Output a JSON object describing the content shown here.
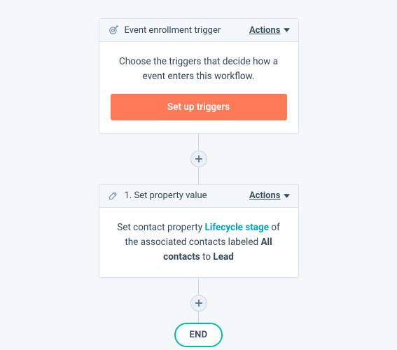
{
  "trigger_card": {
    "title": "Event enrollment trigger",
    "actions_label": "Actions",
    "description": "Choose the triggers that decide how a event enters this workflow.",
    "button_label": "Set up triggers"
  },
  "step1_card": {
    "title": "1. Set property value",
    "actions_label": "Actions",
    "desc_prefix": "Set contact property ",
    "property_name": "Lifecycle stage",
    "desc_mid": " of the associated contacts labeled ",
    "label_name": "All contacts",
    "desc_suffix_to": " to ",
    "value": "Lead"
  },
  "end_label": "END"
}
